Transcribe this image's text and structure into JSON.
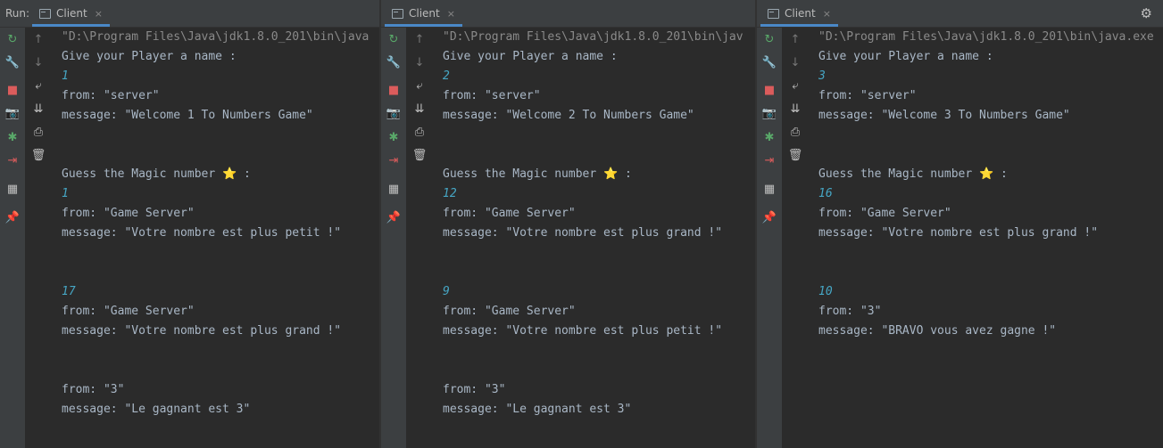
{
  "run_label": "Run:",
  "tab_close_glyph": "×",
  "colors": {
    "background": "#2b2b2b",
    "toolbar": "#3c3f41",
    "text": "#a9b7c6",
    "input_text": "#46a6c4",
    "command_text": "#8a8a8a",
    "tab_underline": "#4a88c7",
    "rerun_green": "#59a869",
    "stop_red": "#db5c5c",
    "star_yellow": "#f5d327"
  },
  "panels": [
    {
      "tab_label": "Client",
      "command": "\"D:\\Program Files\\Java\\jdk1.8.0_201\\bin\\java",
      "lines": [
        {
          "text": "Give your Player a name :",
          "kind": "out"
        },
        {
          "text": "1",
          "kind": "input"
        },
        {
          "text": "from: \"server\"",
          "kind": "out"
        },
        {
          "text": "message: \"Welcome 1 To Numbers Game\"",
          "kind": "out"
        },
        {
          "text": "",
          "kind": "out"
        },
        {
          "text": "",
          "kind": "out"
        },
        {
          "text": "Guess the Magic number ",
          "kind": "out",
          "star": true,
          "suffix": " :"
        },
        {
          "text": "1",
          "kind": "input"
        },
        {
          "text": "from: \"Game Server\"",
          "kind": "out"
        },
        {
          "text": "message: \"Votre nombre est plus petit !\"",
          "kind": "out"
        },
        {
          "text": "",
          "kind": "out"
        },
        {
          "text": "",
          "kind": "out"
        },
        {
          "text": "17",
          "kind": "input"
        },
        {
          "text": "from: \"Game Server\"",
          "kind": "out"
        },
        {
          "text": "message: \"Votre nombre est plus grand !\"",
          "kind": "out"
        },
        {
          "text": "",
          "kind": "out"
        },
        {
          "text": "",
          "kind": "out"
        },
        {
          "text": "from: \"3\"",
          "kind": "out"
        },
        {
          "text": "message: \"Le gagnant est 3\"",
          "kind": "out"
        }
      ]
    },
    {
      "tab_label": "Client",
      "command": "\"D:\\Program Files\\Java\\jdk1.8.0_201\\bin\\jav",
      "lines": [
        {
          "text": "Give your Player a name :",
          "kind": "out"
        },
        {
          "text": "2",
          "kind": "input"
        },
        {
          "text": "from: \"server\"",
          "kind": "out"
        },
        {
          "text": "message: \"Welcome 2 To Numbers Game\"",
          "kind": "out"
        },
        {
          "text": "",
          "kind": "out"
        },
        {
          "text": "",
          "kind": "out"
        },
        {
          "text": "Guess the Magic number ",
          "kind": "out",
          "star": true,
          "suffix": " :"
        },
        {
          "text": "12",
          "kind": "input"
        },
        {
          "text": "from: \"Game Server\"",
          "kind": "out"
        },
        {
          "text": "message: \"Votre nombre est plus grand !\"",
          "kind": "out"
        },
        {
          "text": "",
          "kind": "out"
        },
        {
          "text": "",
          "kind": "out"
        },
        {
          "text": "9",
          "kind": "input"
        },
        {
          "text": "from: \"Game Server\"",
          "kind": "out"
        },
        {
          "text": "message: \"Votre nombre est plus petit !\"",
          "kind": "out"
        },
        {
          "text": "",
          "kind": "out"
        },
        {
          "text": "",
          "kind": "out"
        },
        {
          "text": "from: \"3\"",
          "kind": "out"
        },
        {
          "text": "message: \"Le gagnant est 3\"",
          "kind": "out"
        }
      ]
    },
    {
      "tab_label": "Client",
      "command": "\"D:\\Program Files\\Java\\jdk1.8.0_201\\bin\\java.exe",
      "lines": [
        {
          "text": "Give your Player a name :",
          "kind": "out"
        },
        {
          "text": "3",
          "kind": "input"
        },
        {
          "text": "from: \"server\"",
          "kind": "out"
        },
        {
          "text": "message: \"Welcome 3 To Numbers Game\"",
          "kind": "out"
        },
        {
          "text": "",
          "kind": "out"
        },
        {
          "text": "",
          "kind": "out"
        },
        {
          "text": "Guess the Magic number ",
          "kind": "out",
          "star": true,
          "suffix": " :"
        },
        {
          "text": "16",
          "kind": "input"
        },
        {
          "text": "from: \"Game Server\"",
          "kind": "out"
        },
        {
          "text": "message: \"Votre nombre est plus grand !\"",
          "kind": "out"
        },
        {
          "text": "",
          "kind": "out"
        },
        {
          "text": "",
          "kind": "out"
        },
        {
          "text": "10",
          "kind": "input"
        },
        {
          "text": "from: \"3\"",
          "kind": "out"
        },
        {
          "text": "message: \"BRAVO vous avez gagne !\"",
          "kind": "out"
        }
      ]
    }
  ],
  "tools_left": [
    {
      "icon": "rerun-icon",
      "glyph": "↻",
      "color": "#59a869"
    },
    {
      "icon": "wrench-icon",
      "glyph": "🔧",
      "color": "#c0c0c0"
    },
    {
      "icon": "stop-icon",
      "glyph": "■",
      "color": "#db5c5c"
    },
    {
      "icon": "camera-icon",
      "glyph": "📷",
      "color": "#c0c0c0"
    },
    {
      "icon": "debug-icon",
      "glyph": "✱",
      "color": "#59a869"
    },
    {
      "icon": "exit-icon",
      "glyph": "⇥",
      "color": "#db5c5c"
    },
    {
      "icon": "layout-icon",
      "glyph": "▦",
      "color": "#c0c0c0"
    },
    {
      "icon": "pin-icon",
      "glyph": "📌",
      "color": "#c0c0c0"
    }
  ],
  "tools_right": [
    {
      "icon": "up-arrow-icon",
      "glyph": "↑",
      "color": "#777777"
    },
    {
      "icon": "down-arrow-icon",
      "glyph": "↓",
      "color": "#777777"
    },
    {
      "icon": "soft-wrap-icon",
      "glyph": "⤶",
      "color": "#c0c0c0"
    },
    {
      "icon": "scroll-to-end-icon",
      "glyph": "⇊",
      "color": "#c0c0c0"
    },
    {
      "icon": "print-icon",
      "glyph": "⎙",
      "color": "#c0c0c0"
    },
    {
      "icon": "trash-icon",
      "glyph": "🗑",
      "color": "#c0c0c0"
    }
  ],
  "gear_glyph": "⚙"
}
